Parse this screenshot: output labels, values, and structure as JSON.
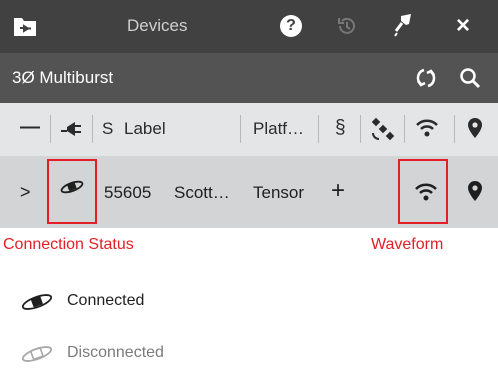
{
  "topbar": {
    "title": "Devices",
    "help_glyph": "?",
    "close_glyph": "×"
  },
  "subbar": {
    "title": "3Ø  Multiburst"
  },
  "columns": {
    "collapse": "—",
    "s": "S",
    "label": "Label",
    "platform": "Platf…",
    "dollar": "§"
  },
  "device_row": {
    "expand": ">",
    "serial": "55605",
    "label": "Scott…",
    "platform": "Tensor",
    "add": "+"
  },
  "annotations": {
    "connection_status": "Connection Status",
    "waveform": "Waveform"
  },
  "legend": {
    "connected": "Connected",
    "disconnected": "Disconnected"
  },
  "colors": {
    "annotation_red": "#e21f26",
    "topbar": "#414141",
    "subbar": "#535353"
  },
  "icons": [
    "folder-icon",
    "help-icon",
    "history-icon",
    "pin-icon",
    "close-icon",
    "refresh-icon",
    "search-icon",
    "plug-icon",
    "satellite-icon",
    "wifi-icon",
    "location-icon",
    "expand-icon",
    "connection-status-icon"
  ]
}
